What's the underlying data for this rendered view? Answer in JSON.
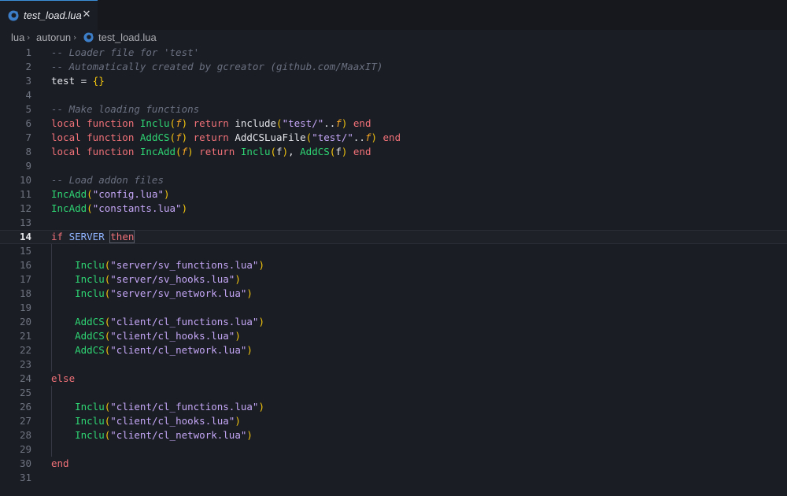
{
  "tab": {
    "label": "test_load.lua",
    "close_glyph": "✕",
    "icon": "lua-file-icon"
  },
  "breadcrumb": {
    "items": [
      "lua",
      "autorun",
      "test_load.lua"
    ],
    "separator": "›"
  },
  "editor": {
    "active_line": 14,
    "lines": [
      {
        "n": "1",
        "tokens": [
          [
            "comment",
            "-- Loader file for 'test'"
          ]
        ]
      },
      {
        "n": "2",
        "tokens": [
          [
            "comment",
            "-- Automatically created by gcreator (github.com/MaaxIT)"
          ]
        ]
      },
      {
        "n": "3",
        "tokens": [
          [
            "ident",
            "test = "
          ],
          [
            "bracket",
            "{}"
          ]
        ]
      },
      {
        "n": "4",
        "tokens": []
      },
      {
        "n": "5",
        "tokens": [
          [
            "comment",
            "-- Make loading functions"
          ]
        ]
      },
      {
        "n": "6",
        "tokens": [
          [
            "keyword",
            "local function "
          ],
          [
            "fn",
            "Inclu"
          ],
          [
            "bracket",
            "("
          ],
          [
            "param",
            "f"
          ],
          [
            "bracket",
            ")"
          ],
          [
            "keyword",
            " return "
          ],
          [
            "builtin",
            "include"
          ],
          [
            "bracket",
            "("
          ],
          [
            "string",
            "\"test/\""
          ],
          [
            "ident",
            ".."
          ],
          [
            "param",
            "f"
          ],
          [
            "bracket",
            ")"
          ],
          [
            "keyword",
            " end"
          ]
        ]
      },
      {
        "n": "7",
        "tokens": [
          [
            "keyword",
            "local function "
          ],
          [
            "fn",
            "AddCS"
          ],
          [
            "bracket",
            "("
          ],
          [
            "param",
            "f"
          ],
          [
            "bracket",
            ")"
          ],
          [
            "keyword",
            " return "
          ],
          [
            "builtin",
            "AddCSLuaFile"
          ],
          [
            "bracket",
            "("
          ],
          [
            "string",
            "\"test/\""
          ],
          [
            "ident",
            ".."
          ],
          [
            "param",
            "f"
          ],
          [
            "bracket",
            ")"
          ],
          [
            "keyword",
            " end"
          ]
        ]
      },
      {
        "n": "8",
        "tokens": [
          [
            "keyword",
            "local function "
          ],
          [
            "fn",
            "IncAdd"
          ],
          [
            "bracket",
            "("
          ],
          [
            "param",
            "f"
          ],
          [
            "bracket",
            ")"
          ],
          [
            "keyword",
            " return "
          ],
          [
            "fn",
            "Inclu"
          ],
          [
            "bracket",
            "("
          ],
          [
            "ident",
            "f"
          ],
          [
            "bracket",
            ")"
          ],
          [
            "ident",
            ", "
          ],
          [
            "fn",
            "AddCS"
          ],
          [
            "bracket",
            "("
          ],
          [
            "ident",
            "f"
          ],
          [
            "bracket",
            ")"
          ],
          [
            "keyword",
            " end"
          ]
        ]
      },
      {
        "n": "9",
        "tokens": []
      },
      {
        "n": "10",
        "tokens": [
          [
            "comment",
            "-- Load addon files"
          ]
        ]
      },
      {
        "n": "11",
        "tokens": [
          [
            "fn",
            "IncAdd"
          ],
          [
            "bracket",
            "("
          ],
          [
            "string",
            "\"config.lua\""
          ],
          [
            "bracket",
            ")"
          ]
        ]
      },
      {
        "n": "12",
        "tokens": [
          [
            "fn",
            "IncAdd"
          ],
          [
            "bracket",
            "("
          ],
          [
            "string",
            "\"constants.lua\""
          ],
          [
            "bracket",
            ")"
          ]
        ]
      },
      {
        "n": "13",
        "tokens": []
      },
      {
        "n": "14",
        "tokens": [
          [
            "keyword",
            "if "
          ],
          [
            "const",
            "SERVER "
          ],
          [
            "then",
            "then"
          ]
        ]
      },
      {
        "n": "15",
        "tokens": []
      },
      {
        "n": "16",
        "tokens": [
          [
            "ident",
            "    "
          ],
          [
            "fn",
            "Inclu"
          ],
          [
            "bracket",
            "("
          ],
          [
            "string",
            "\"server/sv_functions.lua\""
          ],
          [
            "bracket",
            ")"
          ]
        ]
      },
      {
        "n": "17",
        "tokens": [
          [
            "ident",
            "    "
          ],
          [
            "fn",
            "Inclu"
          ],
          [
            "bracket",
            "("
          ],
          [
            "string",
            "\"server/sv_hooks.lua\""
          ],
          [
            "bracket",
            ")"
          ]
        ]
      },
      {
        "n": "18",
        "tokens": [
          [
            "ident",
            "    "
          ],
          [
            "fn",
            "Inclu"
          ],
          [
            "bracket",
            "("
          ],
          [
            "string",
            "\"server/sv_network.lua\""
          ],
          [
            "bracket",
            ")"
          ]
        ]
      },
      {
        "n": "19",
        "tokens": []
      },
      {
        "n": "20",
        "tokens": [
          [
            "ident",
            "    "
          ],
          [
            "fn",
            "AddCS"
          ],
          [
            "bracket",
            "("
          ],
          [
            "string",
            "\"client/cl_functions.lua\""
          ],
          [
            "bracket",
            ")"
          ]
        ]
      },
      {
        "n": "21",
        "tokens": [
          [
            "ident",
            "    "
          ],
          [
            "fn",
            "AddCS"
          ],
          [
            "bracket",
            "("
          ],
          [
            "string",
            "\"client/cl_hooks.lua\""
          ],
          [
            "bracket",
            ")"
          ]
        ]
      },
      {
        "n": "22",
        "tokens": [
          [
            "ident",
            "    "
          ],
          [
            "fn",
            "AddCS"
          ],
          [
            "bracket",
            "("
          ],
          [
            "string",
            "\"client/cl_network.lua\""
          ],
          [
            "bracket",
            ")"
          ]
        ]
      },
      {
        "n": "23",
        "tokens": []
      },
      {
        "n": "24",
        "tokens": [
          [
            "keyword",
            "else"
          ]
        ]
      },
      {
        "n": "25",
        "tokens": []
      },
      {
        "n": "26",
        "tokens": [
          [
            "ident",
            "    "
          ],
          [
            "fn",
            "Inclu"
          ],
          [
            "bracket",
            "("
          ],
          [
            "string",
            "\"client/cl_functions.lua\""
          ],
          [
            "bracket",
            ")"
          ]
        ]
      },
      {
        "n": "27",
        "tokens": [
          [
            "ident",
            "    "
          ],
          [
            "fn",
            "Inclu"
          ],
          [
            "bracket",
            "("
          ],
          [
            "string",
            "\"client/cl_hooks.lua\""
          ],
          [
            "bracket",
            ")"
          ]
        ]
      },
      {
        "n": "28",
        "tokens": [
          [
            "ident",
            "    "
          ],
          [
            "fn",
            "Inclu"
          ],
          [
            "bracket",
            "("
          ],
          [
            "string",
            "\"client/cl_network.lua\""
          ],
          [
            "bracket",
            ")"
          ]
        ]
      },
      {
        "n": "29",
        "tokens": []
      },
      {
        "n": "30",
        "tokens": [
          [
            "keyword",
            "end"
          ]
        ]
      },
      {
        "n": "31",
        "tokens": []
      }
    ]
  },
  "colors": {
    "background": "#1b1d24",
    "tab_accent": "#3b8fd9",
    "keyword": "#f07178",
    "function": "#2ed573",
    "string": "#c3a6f5",
    "parameter": "#f5a623",
    "comment": "#6a7080"
  }
}
